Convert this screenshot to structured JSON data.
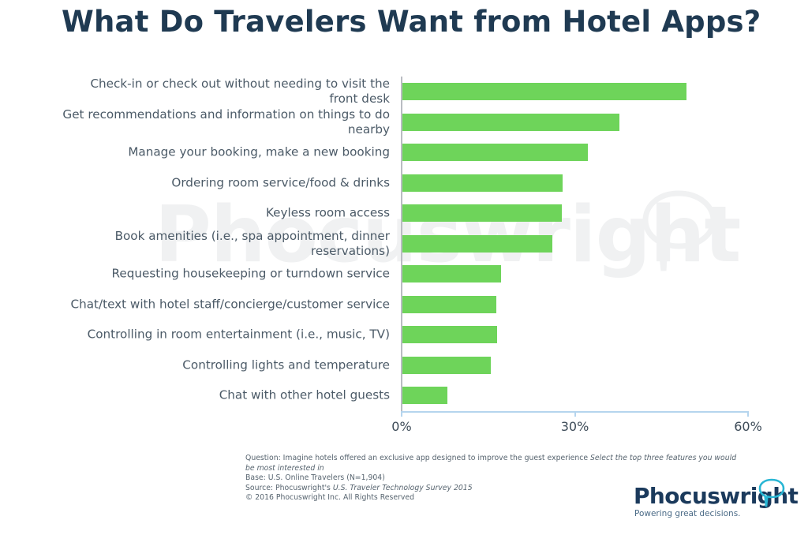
{
  "title": "What Do Travelers Want from Hotel Apps?",
  "watermark": {
    "text": "Phocuswright",
    "bubble_icon": "speech-bubble-icon"
  },
  "chart_data": {
    "type": "bar",
    "orientation": "horizontal",
    "title": "What Do Travelers Want from Hotel Apps?",
    "xlabel": "",
    "ylabel": "",
    "xlim": [
      0,
      60
    ],
    "xticks": [
      0,
      30,
      60
    ],
    "xtick_labels": [
      "0%",
      "30%",
      "60%"
    ],
    "grid": false,
    "legend": false,
    "bar_color": "#6ed45a",
    "categories": [
      "Check-in or check out without needing to visit the front desk",
      "Get recommendations and information on things to do nearby",
      "Manage your booking, make a new booking",
      "Ordering room service/food & drinks",
      "Keyless room access",
      "Book amenities (i.e., spa appointment, dinner reservations)",
      "Requesting housekeeping or turndown service",
      "Chat/text with hotel staff/concierge/customer service",
      "Controlling in room entertainment (i.e., music, TV)",
      "Controlling lights and temperature",
      "Chat with other hotel guests"
    ],
    "values": [
      49.2,
      37.6,
      32.1,
      27.8,
      27.6,
      25.9,
      17.1,
      16.3,
      16.4,
      15.3,
      7.8
    ]
  },
  "axis": {
    "ticks": [
      {
        "label": "0%",
        "value": 0
      },
      {
        "label": "30%",
        "value": 30
      },
      {
        "label": "60%",
        "value": 60
      }
    ]
  },
  "footnotes": {
    "question_prefix": "Question: Imagine hotels offered an exclusive app designed to improve the guest experience ",
    "question_italic": "Select the top three features you would be most interested in",
    "base": " Base: U.S. Online Travelers (N=1,904)",
    "source_prefix": "Source: Phocuswright's ",
    "source_italic": "U.S. Traveler Technology Survey 2015",
    "copyright": "© 2016 Phocuswright Inc. All Rights Reserved"
  },
  "logo": {
    "wordmark": "Phocuswright",
    "tagline": "Powering great decisions.",
    "bubble_icon": "speech-bubble-icon",
    "brand_color": "#1b3a5c",
    "accent_color": "#28b6d4"
  }
}
